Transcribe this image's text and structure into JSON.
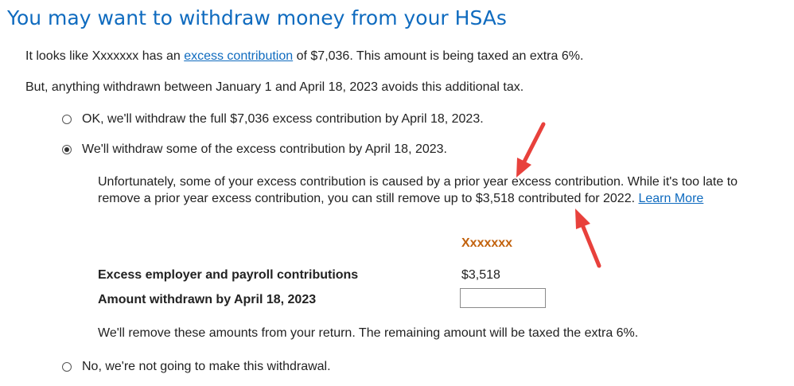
{
  "header": {
    "title": "You may want to withdraw money from your HSAs"
  },
  "intro": {
    "part1": "It looks like Xxxxxxx has an ",
    "link": "excess contribution",
    "part2": " of $7,036. This amount is being taxed an extra 6%."
  },
  "deadline_text": "But, anything withdrawn between January 1 and April 18, 2023 avoids this additional tax.",
  "options": {
    "full": "OK, we'll withdraw the full $7,036 excess contribution by April 18, 2023.",
    "some": "We'll withdraw some of the excess contribution by April 18, 2023.",
    "none": "No, we're not going to make this withdrawal.",
    "selected": "some"
  },
  "explanation": {
    "text": "Unfortunately, some of your excess contribution is caused by a prior year excess contribution. While it's too late to remove a prior year excess contribution, you can still remove up to $3,518 contributed for 2022. ",
    "link": "Learn More"
  },
  "table": {
    "column_header": "Xxxxxxx",
    "rows": [
      {
        "label": "Excess employer and payroll contributions",
        "value": "$3,518"
      },
      {
        "label": "Amount withdrawn by April 18, 2023",
        "value": ""
      }
    ]
  },
  "note": "We'll remove these amounts from your return. The remaining amount will be taxed the extra 6%.",
  "colors": {
    "title": "#0f6bbf",
    "link": "#0f6bbf",
    "column_header": "#c2620d",
    "annotation_arrow": "#e8413c"
  },
  "annotations": [
    "arrow-icon",
    "arrow-icon"
  ]
}
